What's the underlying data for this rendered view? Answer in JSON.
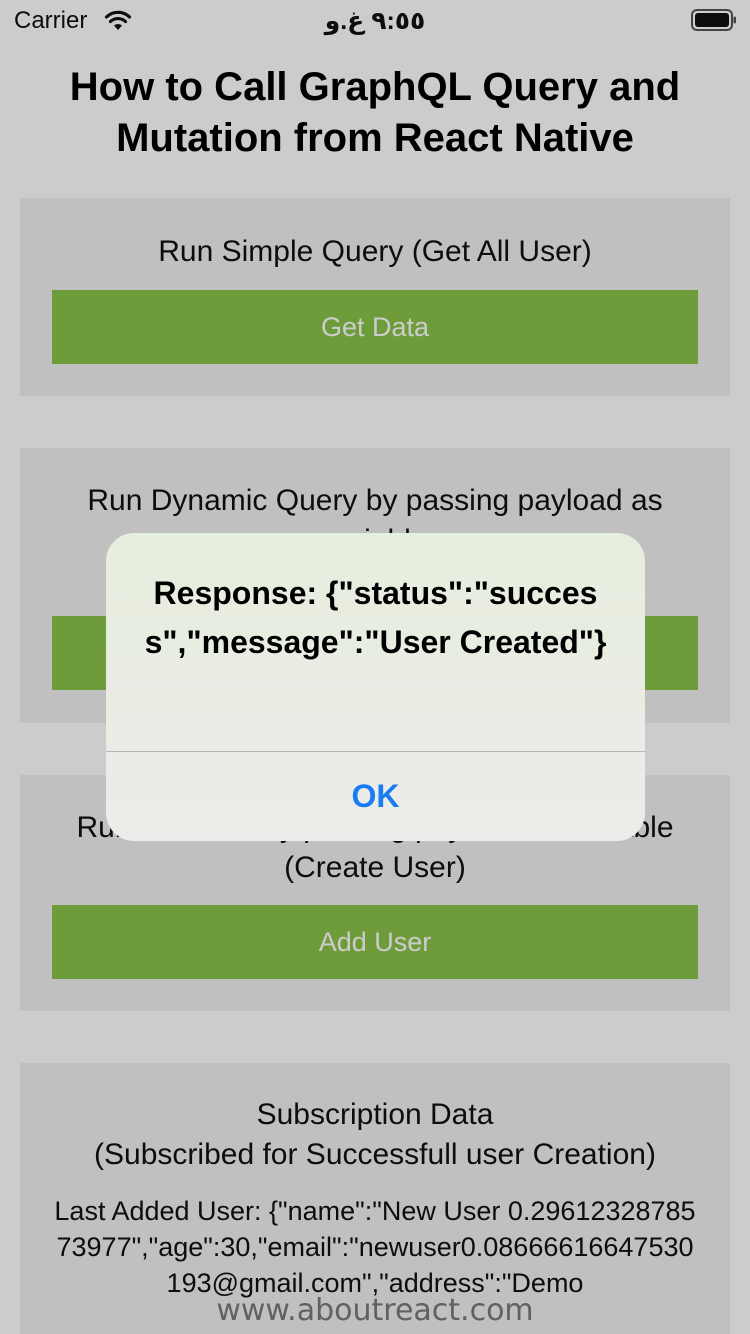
{
  "status_bar": {
    "carrier": "Carrier",
    "time": "٩:٥٥ غ.و",
    "icons": [
      "wifi-icon",
      "battery-icon"
    ]
  },
  "page": {
    "title": "How to Call GraphQL Query and Mutation from React Native",
    "cards": [
      {
        "title": "Run Simple Query (Get All User)",
        "button": "Get Data"
      },
      {
        "title": "Run Dynamic Query by passing payload as variable"
      },
      {
        "title": "Run Mutation by passing payload as variable (Create User)",
        "button": "Add User"
      },
      {
        "title": "Subscription Data",
        "subtitle": "(Subscribed for Successfull user Creation)",
        "last_added": "Last Added User: {\"name\":\"New User 0.2961232878573977\",\"age\":30,\"email\":\"newuser0.08666616647530193@gmail.com\",\"address\":\"Demo"
      }
    ],
    "footer": "www.aboutreact.com"
  },
  "alert": {
    "message": "Response: {\"status\":\"success\",\"message\":\"User Created\"}",
    "ok_label": "OK"
  },
  "colors": {
    "button_green": "#8bc34a",
    "card_bg": "#f0f0f0",
    "alert_ok_blue": "#1a7cf2"
  }
}
